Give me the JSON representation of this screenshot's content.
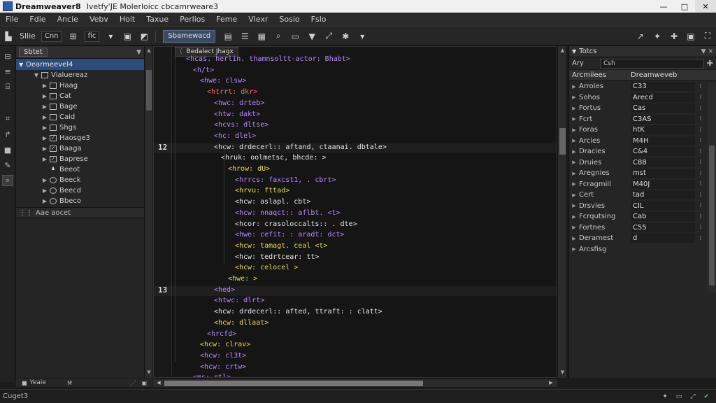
{
  "titlebar": {
    "app_name": "Dreamweaver8",
    "doc_title": "Ivetfy'JE Molerloicc cbcamrweare3",
    "minimize": "—",
    "maximize": "□",
    "close": "✕"
  },
  "menu": [
    "File",
    "Fdie",
    "Ancie",
    "Vebv",
    "Hoit",
    "Taxue",
    "Perlios",
    "Feme",
    "Vlexr",
    "Sosio",
    "Fslo"
  ],
  "toolbar": {
    "label1": "Sllie",
    "select1": "Cnn",
    "select2": "fic",
    "active_label": "Sbamewacd"
  },
  "files_panel": {
    "tab_label": "Sbtet",
    "root": "Dearmeevel4",
    "items": [
      {
        "label": "Vialuereaz",
        "icon": "folder",
        "twisty": "▼",
        "indent": 2
      },
      {
        "label": "Haag",
        "icon": "file",
        "twisty": "▶",
        "indent": 3
      },
      {
        "label": "Cat",
        "icon": "file",
        "twisty": "▶",
        "indent": 3
      },
      {
        "label": "Bage",
        "icon": "file",
        "twisty": "▶",
        "indent": 3
      },
      {
        "label": "Caid",
        "icon": "file",
        "twisty": "▶",
        "indent": 3
      },
      {
        "label": "Shgs",
        "icon": "file",
        "twisty": "▶",
        "indent": 3
      },
      {
        "label": "Haosge3",
        "icon": "check",
        "twisty": "▶",
        "indent": 3
      },
      {
        "label": "Baaga",
        "icon": "check",
        "twisty": "▶",
        "indent": 3
      },
      {
        "label": "Baprese",
        "icon": "check",
        "twisty": "▶",
        "indent": 3
      },
      {
        "label": "Beeot",
        "icon": "person",
        "twisty": "",
        "indent": 3
      },
      {
        "label": "Beeck",
        "icon": "circle",
        "twisty": "▶",
        "indent": 3
      },
      {
        "label": "Beecd",
        "icon": "circle",
        "twisty": "▶",
        "indent": 3
      },
      {
        "label": "Bbeco",
        "icon": "circle",
        "twisty": "▶",
        "indent": 3
      }
    ],
    "footer": "Aae aocet",
    "bottom_label": "Yeaie"
  },
  "editor": {
    "tab_label": "Bedalect Jhagx",
    "line_numbers": [
      "12",
      "13"
    ],
    "lines": [
      {
        "t": "<hcas. herlin. thamnsoltt-actor: Bhabt>",
        "c": "c-tag",
        "i": 0
      },
      {
        "t": "<h/t>",
        "c": "c-tag",
        "i": 1
      },
      {
        "t": "<hwe: clsw>",
        "c": "c-tag",
        "i": 2
      },
      {
        "t": "<htrrt: dkr>",
        "c": "c-red",
        "i": 3
      },
      {
        "t": "<hwc: drteb>",
        "c": "c-tag",
        "i": 4
      },
      {
        "t": "<htw: dakt>",
        "c": "c-tag",
        "i": 4
      },
      {
        "t": "<hcvs: dltse>",
        "c": "c-tag",
        "i": 4
      },
      {
        "t": "<hc: dlel>",
        "c": "c-tag",
        "i": 4
      },
      {
        "t": "<hcw: drdecerl:: aftand, ctaanai. dbtale>",
        "c": "c-white",
        "i": 4
      },
      {
        "t": "<hruk: oolmetsc, bhcde: >",
        "c": "c-white",
        "i": 5
      },
      {
        "t": "<hrow: dU>",
        "c": "c-yellow",
        "i": 6
      },
      {
        "t": "<hrrcs: faxcst1, . cbrt>",
        "c": "c-tag",
        "i": 7
      },
      {
        "t": "<hrvu: fttad>",
        "c": "c-yellow",
        "i": 7
      },
      {
        "t": "<hcw: aslapl. cbt>",
        "c": "c-white",
        "i": 7
      },
      {
        "t": "<hcw: nnaqct:: aflbt. <t>",
        "c": "c-tag",
        "i": 7
      },
      {
        "t": "<hcor: crasoloccalts:: . dte>",
        "c": "c-white",
        "i": 7
      },
      {
        "t": "<hwe: cefit: : aradt: dct>",
        "c": "c-tag",
        "i": 7
      },
      {
        "t": "<hcw: tamagt. ceal <t>",
        "c": "c-yellow",
        "i": 7
      },
      {
        "t": "<hcw: tedrtcear: tt>",
        "c": "c-white",
        "i": 7
      },
      {
        "t": "<hcw: celocel >",
        "c": "c-yellow",
        "i": 7
      },
      {
        "t": "<hwe: >",
        "c": "c-yellow",
        "i": 6
      },
      {
        "t": "<hed>",
        "c": "c-tag",
        "i": 4
      },
      {
        "t": "<htwc: dlrt>",
        "c": "c-tag",
        "i": 4
      },
      {
        "t": "<hcw: drdecerl:: afted, ttraft: : clatt>",
        "c": "c-white",
        "i": 4
      },
      {
        "t": "<hcw: dllaat>",
        "c": "c-yellow",
        "i": 4
      },
      {
        "t": "<hrcfd>",
        "c": "c-tag",
        "i": 3
      },
      {
        "t": "<hcw: clrav>",
        "c": "c-yellow",
        "i": 2
      },
      {
        "t": "<hcw: cl3t>",
        "c": "c-tag",
        "i": 2
      },
      {
        "t": "<hcw: crtw>",
        "c": "c-tag",
        "i": 2
      },
      {
        "t": "<ms: ntl>",
        "c": "c-tag",
        "i": 1
      }
    ]
  },
  "properties": {
    "header": "Totcs",
    "search_label": "Ary",
    "search_value": "Csh",
    "col1": "Arcmiiees",
    "col2": "Dreamweveb",
    "rows": [
      {
        "name": "Arroles",
        "value": "C33"
      },
      {
        "name": "Sohos",
        "value": "Arecd"
      },
      {
        "name": "Fortus",
        "value": "Cas"
      },
      {
        "name": "Fcrt",
        "value": "C3AS"
      },
      {
        "name": "Foras",
        "value": "htK"
      },
      {
        "name": "Arcies",
        "value": "M4H"
      },
      {
        "name": "Dracies",
        "value": "C&4"
      },
      {
        "name": "Druies",
        "value": "C88"
      },
      {
        "name": "Aregnies",
        "value": "mst"
      },
      {
        "name": "Fcragmiil",
        "value": "M40J"
      },
      {
        "name": "Cert",
        "value": "tad"
      },
      {
        "name": "Drsvies",
        "value": "CIL"
      },
      {
        "name": "Fcrqutsing",
        "value": "Cab"
      },
      {
        "name": "Fortnes",
        "value": "C55"
      },
      {
        "name": "Deramest",
        "value": "d"
      },
      {
        "name": "Arcsfisg",
        "value": ""
      }
    ]
  },
  "statusbar": {
    "left": "Cuget3"
  }
}
